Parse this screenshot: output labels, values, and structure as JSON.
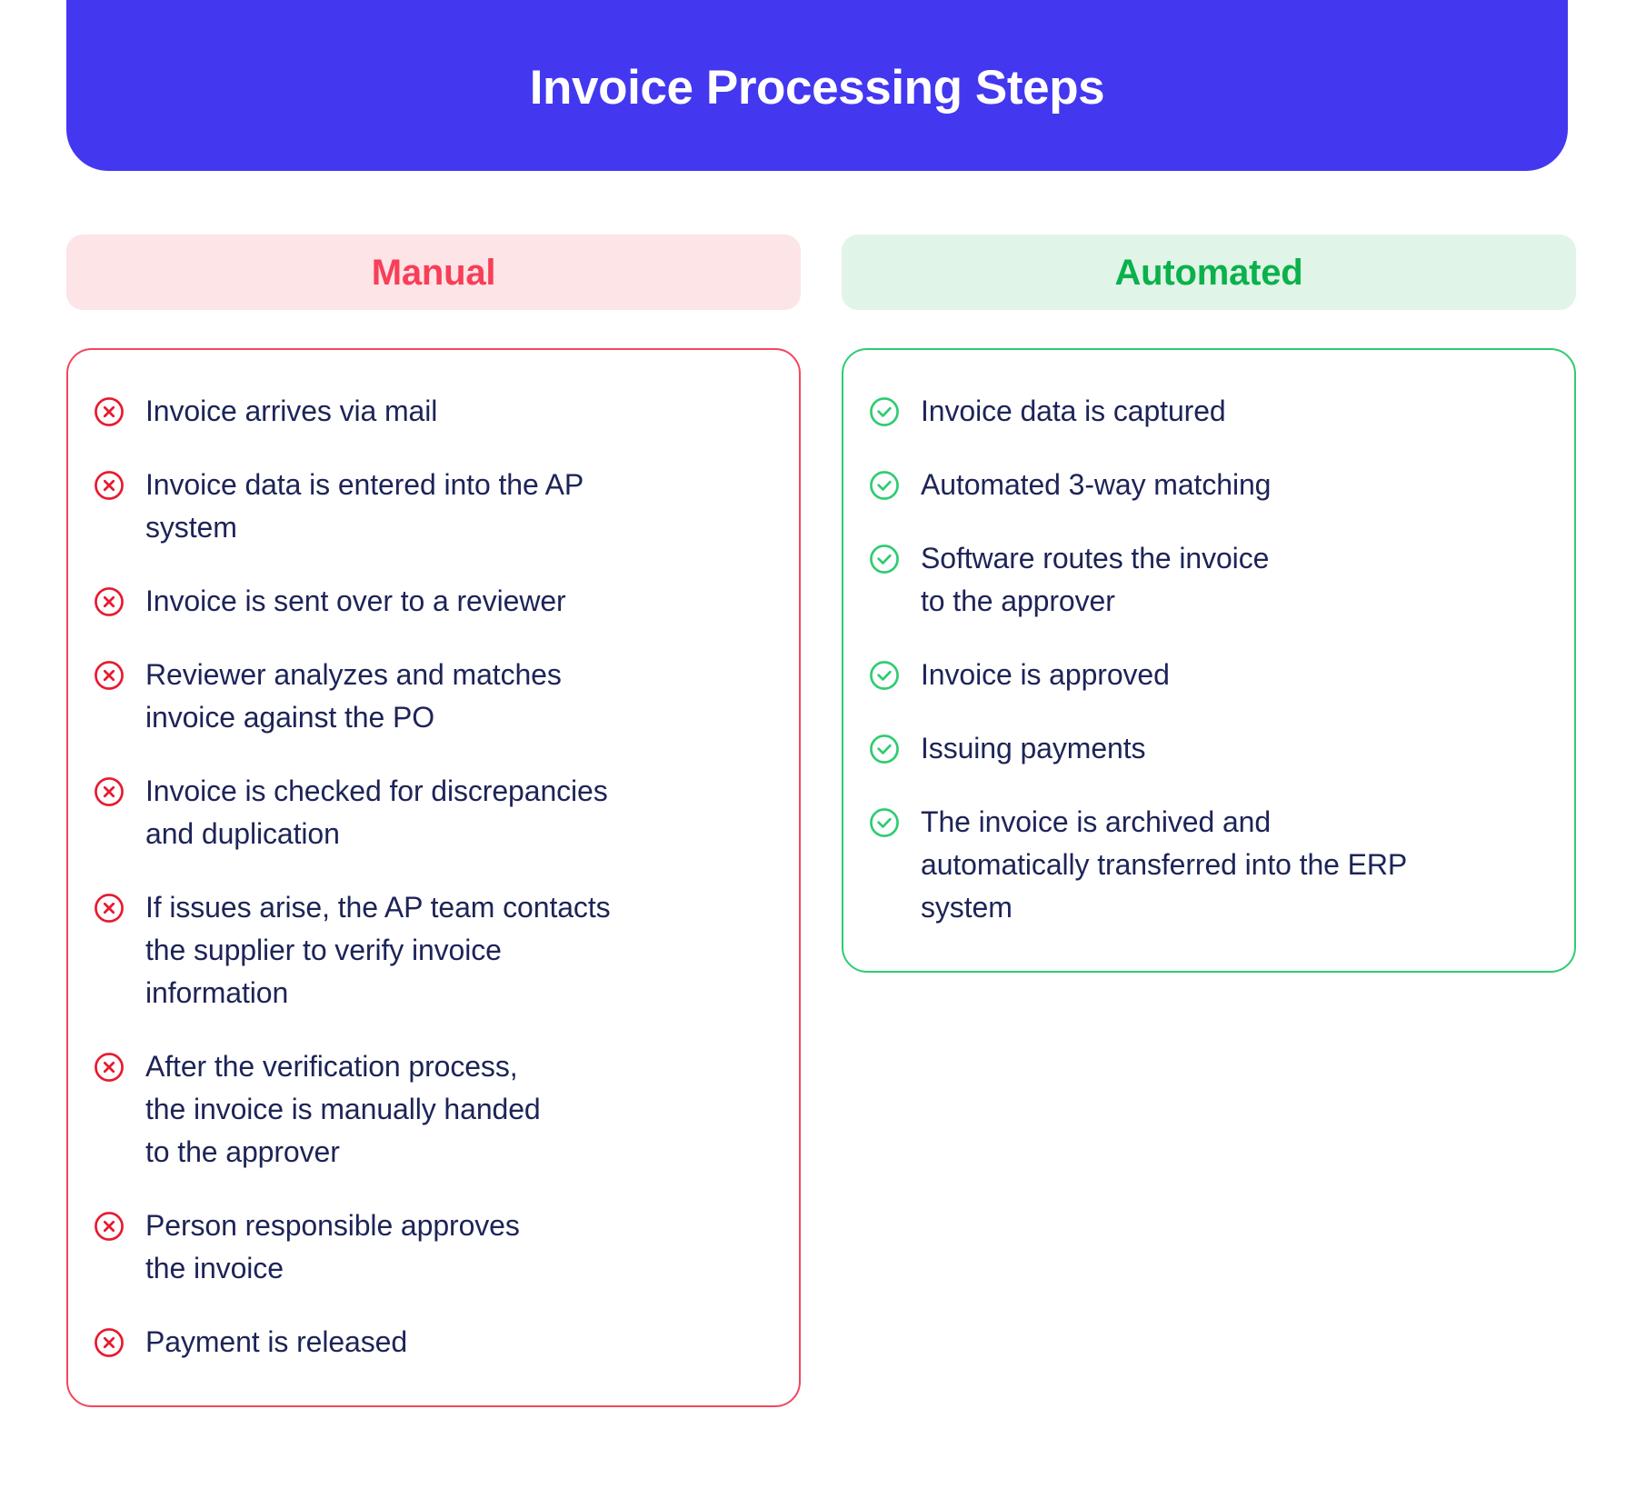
{
  "header": {
    "title": "Invoice Processing Steps",
    "background_color": "#4338f0",
    "text_color": "#ffffff"
  },
  "columns": [
    {
      "key": "manual",
      "label": "Manual",
      "label_color": "#f73f58",
      "pill_background": "#fde4e6",
      "card_border_color": "#f4465c",
      "icon": "circle-x-icon",
      "icon_color": "#e8192f",
      "steps": [
        "Invoice arrives via mail",
        "Invoice data is entered into the AP\nsystem",
        "Invoice is sent over to a reviewer",
        "Reviewer analyzes and matches\ninvoice against the PO",
        "Invoice is checked for discrepancies\nand duplication",
        "If issues arise, the AP team contacts\nthe supplier to verify invoice\ninformation",
        "After the verification process,\nthe invoice is manually handed\nto the approver",
        "Person responsible approves\nthe invoice",
        "Payment is released"
      ]
    },
    {
      "key": "automated",
      "label": "Automated",
      "label_color": "#0bb14b",
      "pill_background": "#e1f4e8",
      "card_border_color": "#2ecc71",
      "icon": "circle-check-icon",
      "icon_color": "#2ecc71",
      "steps": [
        "Invoice data is captured",
        "Automated 3-way matching",
        "Software routes the invoice\nto the approver",
        "Invoice is approved",
        "Issuing payments",
        "The invoice is archived and\nautomatically transferred into the ERP\nsystem"
      ]
    }
  ]
}
